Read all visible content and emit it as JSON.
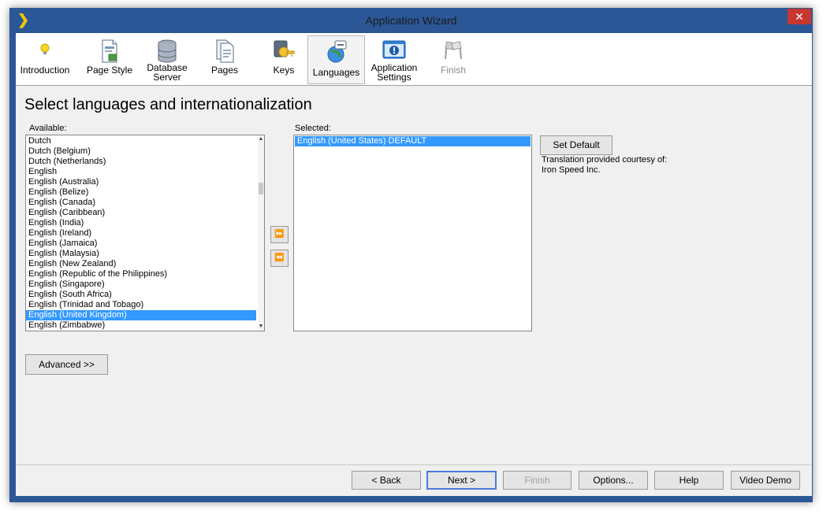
{
  "window": {
    "title": "Application Wizard",
    "close_symbol": "✕"
  },
  "toolbar": {
    "steps": [
      {
        "label": "Introduction",
        "icon": "lightbulb-icon"
      },
      {
        "label1": "Page Style",
        "icon": "page-style-icon"
      },
      {
        "label1": "Database",
        "label2": "Server",
        "icon": "database-icon"
      },
      {
        "label1": "Pages",
        "icon": "pages-icon"
      },
      {
        "label1": "Keys",
        "icon": "keys-icon"
      },
      {
        "label1": "Languages",
        "icon": "globe-icon",
        "active": true
      },
      {
        "label1": "Application",
        "label2": "Settings",
        "icon": "settings-icon"
      },
      {
        "label1": "Finish",
        "icon": "checkered-flags-icon",
        "disabled": true
      }
    ]
  },
  "main": {
    "heading": "Select languages and internationalization",
    "available_label": "Available:",
    "selected_label": "Selected:",
    "available_items": [
      "Dutch",
      "Dutch (Belgium)",
      "Dutch (Netherlands)",
      "English",
      "English (Australia)",
      "English (Belize)",
      "English (Canada)",
      "English (Caribbean)",
      "English (India)",
      "English (Ireland)",
      "English (Jamaica)",
      "English (Malaysia)",
      "English (New Zealand)",
      "English (Republic of the Philippines)",
      "English (Singapore)",
      "English (South Africa)",
      "English (Trinidad and Tobago)",
      "English (United Kingdom)",
      "English (Zimbabwe)"
    ],
    "available_selected_index": 17,
    "selected_items": [
      "English (United States) DEFAULT"
    ],
    "add_symbol": "⏩",
    "remove_symbol": "⏪",
    "set_default_label": "Set Default",
    "translation_note_1": "Translation provided courtesy of:",
    "translation_note_2": "Iron Speed Inc.",
    "advanced_label": "Advanced >>"
  },
  "footer": {
    "back": "< Back",
    "next": "Next >",
    "finish": "Finish",
    "options": "Options...",
    "help": "Help",
    "video_demo": "Video Demo"
  },
  "colors": {
    "selection": "#3399ff",
    "title_bar": "#2b5797",
    "close": "#c7372f"
  }
}
